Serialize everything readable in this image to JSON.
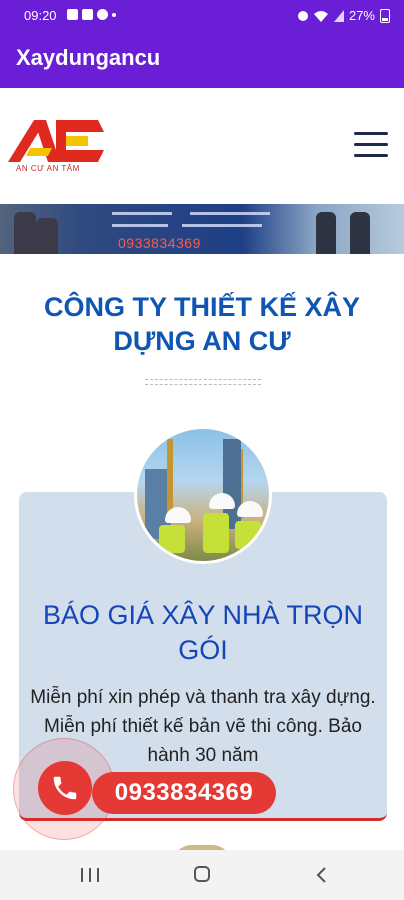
{
  "status_bar": {
    "time": "09:20",
    "battery": "27%",
    "icons": [
      "gallery-icon",
      "image-icon",
      "message-icon",
      "dot-icon",
      "alarm-icon",
      "wifi-icon",
      "signal-icon",
      "battery-icon"
    ]
  },
  "app_bar": {
    "title": "Xaydungancu"
  },
  "header": {
    "logo_tagline": "AN CƯ AN TÂM",
    "logo_colors": {
      "red": "#e12a1f",
      "yellow": "#f5c400"
    },
    "menu_icon": "hamburger-icon"
  },
  "banner": {
    "phone": "0933834369"
  },
  "heading": "CÔNG TY THIẾT KẾ XÂY DỰNG AN CƯ",
  "card": {
    "title": "BÁO GIÁ XÂY NHÀ TRỌN GÓI",
    "text": "Miễn phí xin phép và thanh tra xây dựng. Miễn phí thiết kế bản vẽ thi công. Bảo hành 30 năm"
  },
  "call_button": {
    "phone": "0933834369",
    "color": "#e53935",
    "icon": "phone-icon"
  },
  "nav_bar": {
    "icons": [
      "recents-icon",
      "home-icon",
      "back-icon"
    ]
  }
}
